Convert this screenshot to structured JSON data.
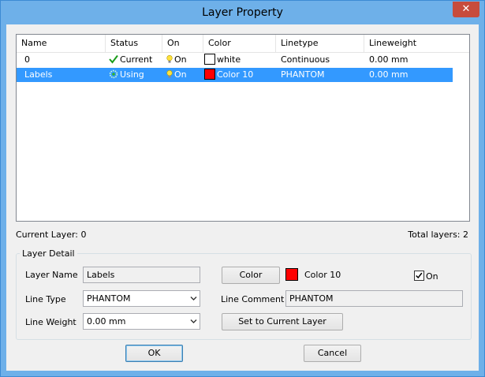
{
  "window": {
    "title": "Layer Property",
    "close_glyph": "✕"
  },
  "list": {
    "columns": [
      "Name",
      "Status",
      "On",
      "Color",
      "Linetype",
      "Lineweight"
    ],
    "rows": [
      {
        "name": "0",
        "status": "Current",
        "on": "On",
        "color_name": "white",
        "color_hex": "#ffffff",
        "linetype": "Continuous",
        "lineweight": "0.00 mm",
        "selected": false
      },
      {
        "name": "Labels",
        "status": "Using",
        "on": "On",
        "color_name": "Color 10",
        "color_hex": "#ff0000",
        "linetype": "PHANTOM",
        "lineweight": "0.00 mm",
        "selected": true
      }
    ]
  },
  "info": {
    "current_layer": "Current Layer: 0",
    "total_layers": "Total layers: 2"
  },
  "detail": {
    "group_title": "Layer Detail",
    "layer_name_label": "Layer Name",
    "layer_name_value": "Labels",
    "line_type_label": "Line Type",
    "line_type_value": "PHANTOM",
    "line_weight_label": "Line Weight",
    "line_weight_value": "0.00 mm",
    "color_button": "Color",
    "color_hex": "#ff0000",
    "color_name": "Color 10",
    "on_label": "On",
    "on_checked": true,
    "line_comment_label": "Line Comment",
    "line_comment_value": "PHANTOM",
    "set_current_button": "Set to Current Layer"
  },
  "buttons": {
    "ok": "OK",
    "cancel": "Cancel"
  },
  "icons": {
    "current_status": "check-icon",
    "using_status": "gear-icon",
    "on_state": "lightbulb-icon",
    "dropdown": "chevron-down-icon"
  }
}
